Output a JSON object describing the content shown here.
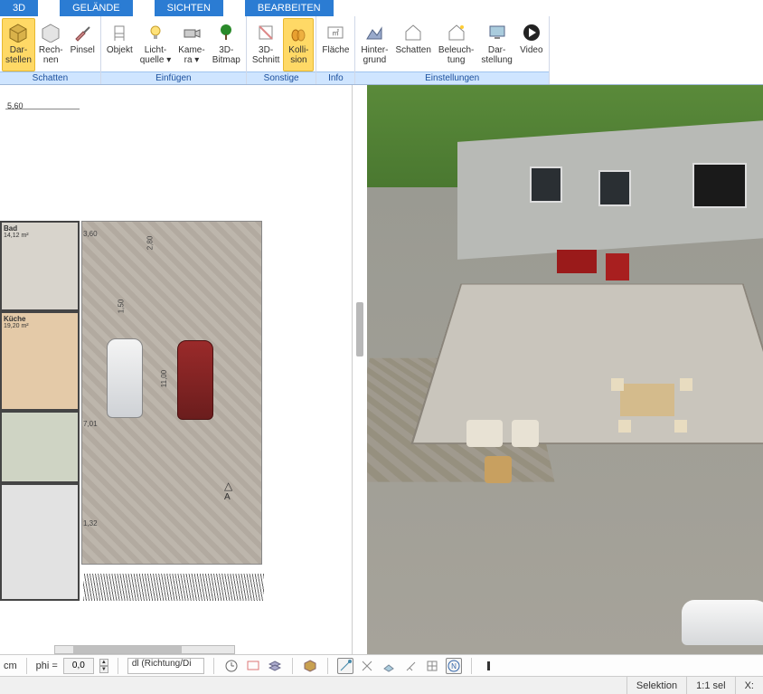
{
  "tabs": {
    "t3d": "3D",
    "gelaende": "GELÄNDE",
    "sichten": "SICHTEN",
    "bearbeiten": "BEARBEITEN"
  },
  "ribbon": {
    "schatten": {
      "label": "Schatten",
      "darstellen": "Dar-\nstellen",
      "rechnen": "Rech-\nnen",
      "pinsel": "Pinsel"
    },
    "einfuegen": {
      "label": "Einfügen",
      "objekt": "Objekt",
      "lichtquelle": "Licht-\nquelle ▾",
      "kamera": "Kame-\nra ▾",
      "bitmap": "3D-\nBitmap"
    },
    "sonstige": {
      "label": "Sonstige",
      "schnitt": "3D-\nSchnitt",
      "kollision": "Kolli-\nsion"
    },
    "info": {
      "label": "Info",
      "flaeche": "Fläche"
    },
    "einstellungen": {
      "label": "Einstellungen",
      "hintergrund": "Hinter-\ngrund",
      "schatten": "Schatten",
      "beleuchtung": "Beleuch-\ntung",
      "darstellung": "Dar-\nstellung",
      "video": "Video"
    }
  },
  "plan": {
    "dim_top": "5,60",
    "bath_label": "Bad",
    "bath_area": "14,12 m²",
    "kitchen_label": "Küche",
    "kitchen_area": "19,20 m²",
    "sec_marker": "A",
    "dims": {
      "d1": "3,60",
      "d2": "2,80",
      "d3": "11,00",
      "d4": "1,50",
      "d5": "7,01",
      "d6": "1,32"
    }
  },
  "bottombar": {
    "unit": "cm",
    "phi": "phi =",
    "phi_val": "0,0",
    "mode": "dl (Richtung/Di"
  },
  "status": {
    "selektion": "Selektion",
    "scale": "1:1 sel",
    "x": "X:"
  }
}
